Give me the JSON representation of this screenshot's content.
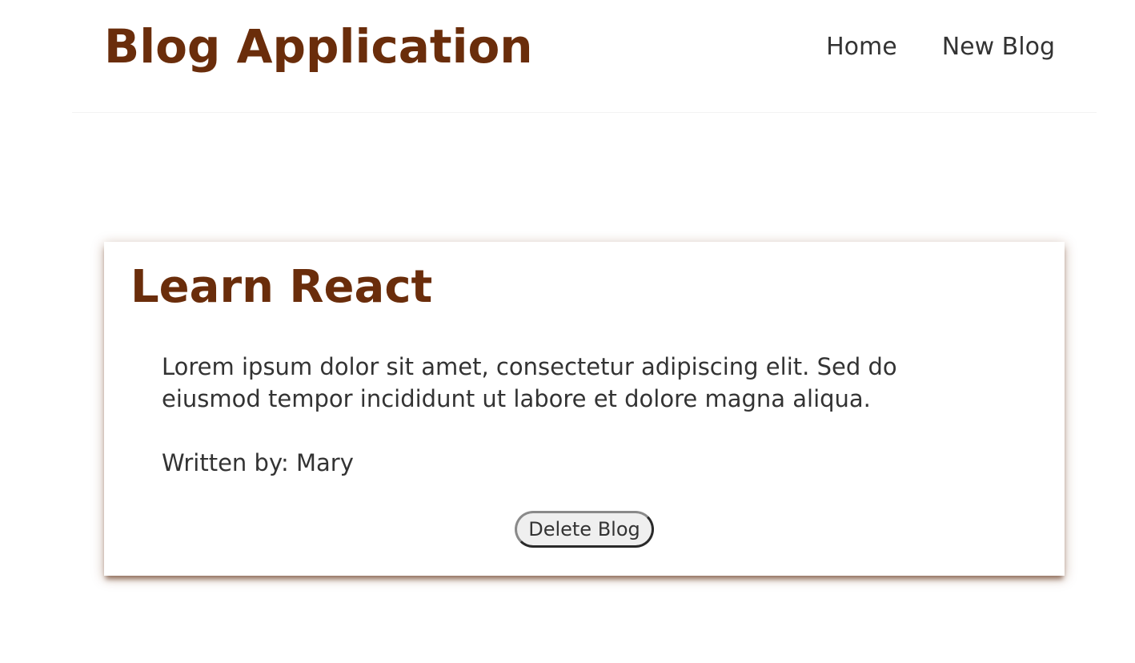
{
  "app": {
    "title": "Blog Application"
  },
  "nav": {
    "links": [
      {
        "label": "Home"
      },
      {
        "label": "New Blog"
      }
    ]
  },
  "blog": {
    "title": "Learn React",
    "body": "Lorem ipsum dolor sit amet, consectetur adipiscing elit. Sed do eiusmod tempor incididunt ut labore et dolore magna aliqua.",
    "author": "Written by: Mary",
    "delete_label": "Delete Blog"
  },
  "colors": {
    "brand": "#6a2d0b",
    "text": "#333333",
    "background": "#ffffff"
  }
}
